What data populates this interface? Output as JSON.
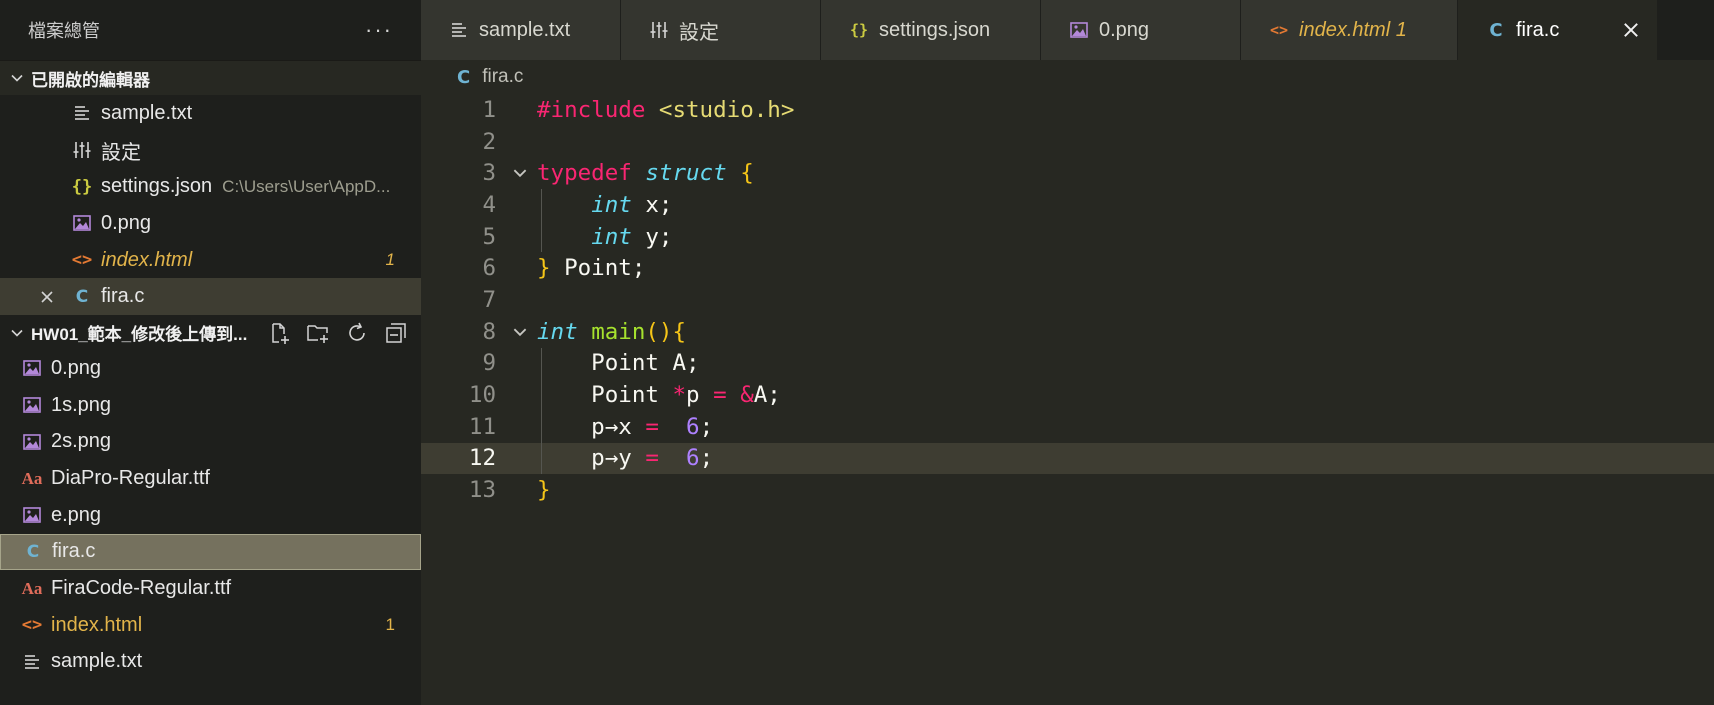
{
  "explorer": {
    "title": "檔案總管",
    "more": "···"
  },
  "open_editors": {
    "title": "已開啟的編輯器",
    "items": [
      {
        "name": "sample.txt",
        "icon": "text-lines-icon"
      },
      {
        "name": "設定",
        "icon": "settings-sliders-icon"
      },
      {
        "name": "settings.json",
        "icon": "json-braces-icon",
        "path": "C:\\Users\\User\\AppD..."
      },
      {
        "name": "0.png",
        "icon": "image-icon"
      },
      {
        "name": "index.html",
        "icon": "html-icon",
        "badge": "1"
      },
      {
        "name": "fira.c",
        "icon": "c-icon"
      }
    ]
  },
  "folder": {
    "title": "HW01_範本_修改後上傳到...",
    "items": [
      {
        "name": "0.png"
      },
      {
        "name": "1s.png"
      },
      {
        "name": "2s.png"
      },
      {
        "name": "DiaPro-Regular.ttf"
      },
      {
        "name": "e.png"
      },
      {
        "name": "fira.c"
      },
      {
        "name": "FiraCode-Regular.ttf"
      },
      {
        "name": "index.html",
        "badge": "1"
      },
      {
        "name": "sample.txt"
      }
    ]
  },
  "tabs": [
    {
      "label": "sample.txt"
    },
    {
      "label": "設定"
    },
    {
      "label": "settings.json"
    },
    {
      "label": "0.png"
    },
    {
      "label": "index.html 1"
    },
    {
      "label": "fira.c"
    }
  ],
  "icons": {
    "c": "C",
    "json": "{}",
    "html": "<>",
    "font": "Aa"
  },
  "editor": {
    "breadcrumb": "fira.c",
    "line_numbers": [
      "1",
      "2",
      "3",
      "4",
      "5",
      "6",
      "7",
      "8",
      "9",
      "10",
      "11",
      "12",
      "13"
    ],
    "current_line": 12
  },
  "colors": {
    "background": "#272822",
    "keyword": "#f92672",
    "type": "#66d9ef",
    "function": "#a6e22e",
    "string": "#e6db74",
    "number": "#ae81ff",
    "bracket": "#f5c518",
    "modified": "#e2b44a"
  }
}
